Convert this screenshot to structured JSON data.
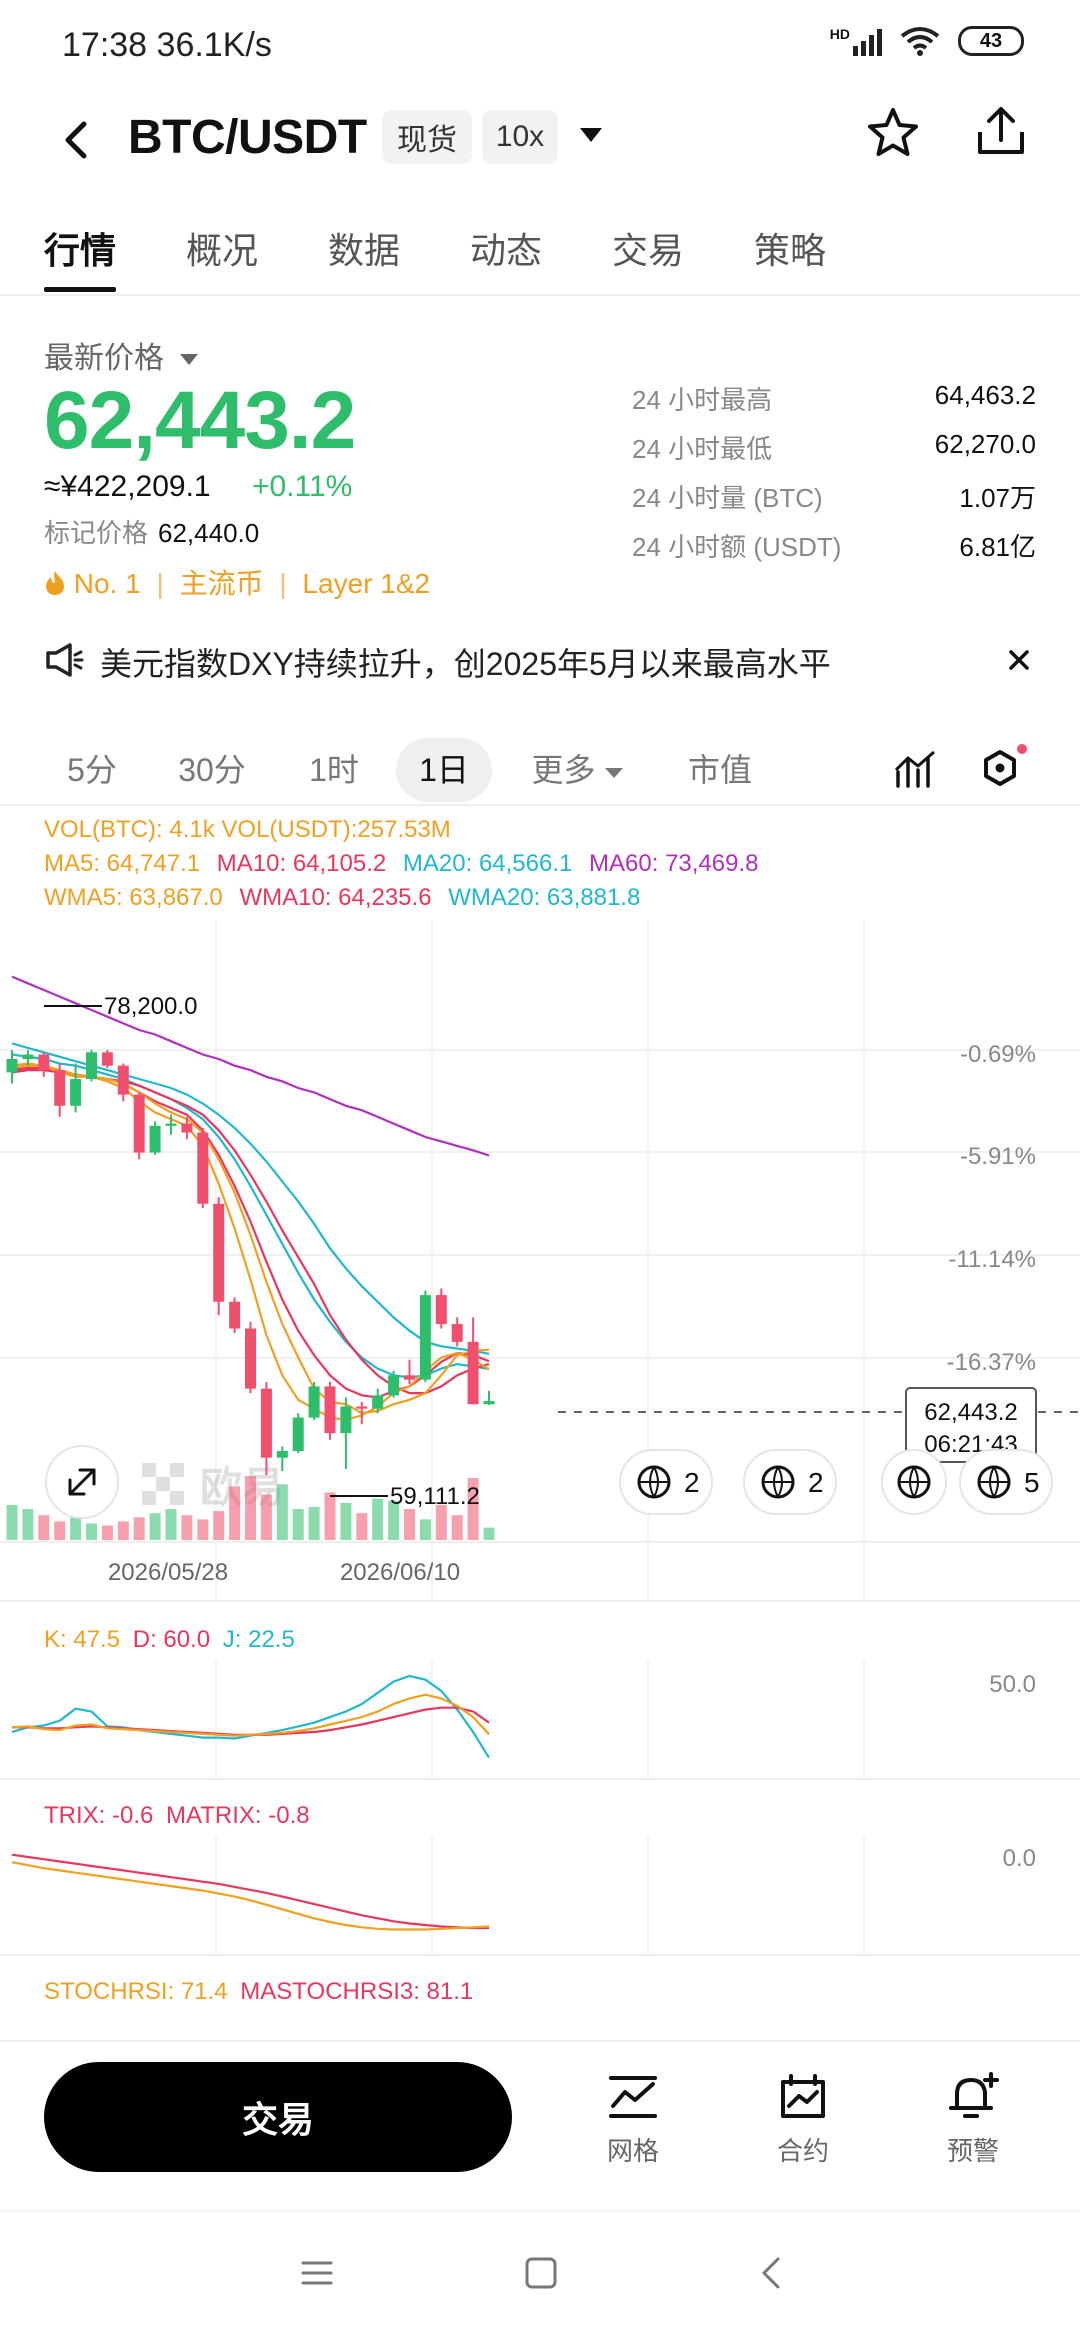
{
  "status_bar": {
    "time": "17:38",
    "speed": "36.1K/s",
    "network": "HD",
    "battery": "43"
  },
  "header": {
    "pair": "BTC/USDT",
    "market_tag": "现货",
    "leverage_tag": "10x"
  },
  "tabs": [
    "行情",
    "概况",
    "数据",
    "动态",
    "交易",
    "策略"
  ],
  "price": {
    "label": "最新价格",
    "last": "62,443.2",
    "cny": "≈¥422,209.1",
    "change": "+0.11%",
    "mark_label": "标记价格",
    "mark_value": "62,440.0",
    "badges": [
      "No. 1",
      "主流币",
      "Layer 1&2"
    ]
  },
  "stats": [
    {
      "label": "24 小时最高",
      "value": "64,463.2"
    },
    {
      "label": "24 小时最低",
      "value": "62,270.0"
    },
    {
      "label": "24 小时量 (BTC)",
      "value": "1.07万"
    },
    {
      "label": "24 小时额 (USDT)",
      "value": "6.81亿"
    }
  ],
  "news": {
    "text": "美元指数DXY持续拉升，创2025年5月以来最高水平"
  },
  "periods": [
    "5分",
    "30分",
    "1时",
    "1日",
    "更多",
    "市值"
  ],
  "active_period": "1日",
  "indicators": {
    "vol_btc": "VOL(BTC): 4.1k",
    "vol_usdt": "VOL(USDT):257.53M",
    "ma5": "MA5: 64,747.1",
    "ma10": "MA10: 64,105.2",
    "ma20": "MA20: 64,566.1",
    "ma60": "MA60: 73,469.8",
    "wma5": "WMA5: 63,867.0",
    "wma10": "WMA10: 64,235.6",
    "wma20": "WMA20: 63,881.8",
    "kdj_k": "K: 47.5",
    "kdj_d": "D: 60.0",
    "kdj_j": "J: 22.5",
    "trix": "TRIX: -0.6",
    "matrix": "MATRIX: -0.8",
    "stochrsi": "STOCHRSI: 71.4",
    "mastochrsi": "MASTOCHRSI3: 81.1"
  },
  "chart": {
    "pct_labels": [
      "-0.69%",
      "-5.91%",
      "-11.14%",
      "-16.37%"
    ],
    "high_label": "78,200.0",
    "low_label": "59,111.2",
    "price_tag": "62,443.2",
    "countdown": "06:21:43",
    "dates": [
      "2026/05/28",
      "2026/06/10"
    ],
    "kdj_axis": "50.0",
    "trix_axis": "0.0",
    "event_badges": [
      "2",
      "2",
      "5"
    ],
    "watermark": "欧易"
  },
  "bottom": {
    "trade": "交易",
    "grid": "网格",
    "contract": "合约",
    "alert": "预警"
  },
  "colors": {
    "up": "#2ebd6b",
    "down": "#f0506e",
    "accent": "#f0a020"
  },
  "chart_data": {
    "type": "candlestick",
    "candles": [
      {
        "o": 77200,
        "h": 78200,
        "l": 76700,
        "c": 77800
      },
      {
        "o": 77800,
        "h": 78200,
        "l": 77500,
        "c": 78000
      },
      {
        "o": 78000,
        "h": 78100,
        "l": 77000,
        "c": 77300
      },
      {
        "o": 77300,
        "h": 77600,
        "l": 75200,
        "c": 75700
      },
      {
        "o": 75700,
        "h": 77600,
        "l": 75400,
        "c": 76900
      },
      {
        "o": 76900,
        "h": 78200,
        "l": 76800,
        "c": 78100
      },
      {
        "o": 78100,
        "h": 78200,
        "l": 77400,
        "c": 77500
      },
      {
        "o": 77500,
        "h": 77600,
        "l": 75900,
        "c": 76200
      },
      {
        "o": 76200,
        "h": 76300,
        "l": 73300,
        "c": 73600
      },
      {
        "o": 73600,
        "h": 75000,
        "l": 73500,
        "c": 74800
      },
      {
        "o": 74800,
        "h": 75300,
        "l": 74400,
        "c": 74900
      },
      {
        "o": 74900,
        "h": 75200,
        "l": 74200,
        "c": 74500
      },
      {
        "o": 74500,
        "h": 74700,
        "l": 71100,
        "c": 71300
      },
      {
        "o": 71300,
        "h": 71600,
        "l": 66300,
        "c": 66900
      },
      {
        "o": 66900,
        "h": 67100,
        "l": 65500,
        "c": 65700
      },
      {
        "o": 65700,
        "h": 66000,
        "l": 62800,
        "c": 63000
      },
      {
        "o": 63000,
        "h": 63300,
        "l": 59111.2,
        "c": 59900
      },
      {
        "o": 59900,
        "h": 60400,
        "l": 59300,
        "c": 60200
      },
      {
        "o": 60200,
        "h": 61900,
        "l": 60100,
        "c": 61700
      },
      {
        "o": 61700,
        "h": 63300,
        "l": 61600,
        "c": 63100
      },
      {
        "o": 63100,
        "h": 63300,
        "l": 60700,
        "c": 61000
      },
      {
        "o": 61000,
        "h": 62600,
        "l": 59400,
        "c": 62200
      },
      {
        "o": 62200,
        "h": 62400,
        "l": 61400,
        "c": 62100
      },
      {
        "o": 62100,
        "h": 63000,
        "l": 61900,
        "c": 62700
      },
      {
        "o": 62700,
        "h": 63800,
        "l": 62600,
        "c": 63600
      },
      {
        "o": 63600,
        "h": 64300,
        "l": 63200,
        "c": 63400
      },
      {
        "o": 63400,
        "h": 67400,
        "l": 63300,
        "c": 67200
      },
      {
        "o": 67200,
        "h": 67500,
        "l": 65700,
        "c": 65900
      },
      {
        "o": 65900,
        "h": 66200,
        "l": 64900,
        "c": 65100
      },
      {
        "o": 65100,
        "h": 66200,
        "l": 62300,
        "c": 62300
      },
      {
        "o": 62300,
        "h": 62900,
        "l": 62270,
        "c": 62443.2
      }
    ],
    "volume": [
      34,
      30,
      24,
      18,
      28,
      16,
      14,
      18,
      22,
      26,
      30,
      24,
      20,
      28,
      52,
      62,
      44,
      54,
      30,
      32,
      46,
      36,
      26,
      40,
      38,
      30,
      20,
      34,
      24,
      60,
      12
    ],
    "ma5": [
      77400,
      77500,
      77500,
      77300,
      77100,
      77000,
      76900,
      76700,
      76300,
      75800,
      75400,
      75100,
      74500,
      73300,
      71800,
      69900,
      67800,
      65900,
      64400,
      63000,
      62400,
      62300,
      61900,
      62000,
      62300,
      62500,
      62800,
      63600,
      64500,
      64700,
      64747.1
    ],
    "ma10": [
      77200,
      77300,
      77300,
      77200,
      77100,
      77000,
      76900,
      76800,
      76600,
      76300,
      76000,
      75700,
      75300,
      74600,
      73700,
      72600,
      71400,
      70100,
      68900,
      67700,
      66300,
      65200,
      64300,
      63600,
      63100,
      62800,
      62800,
      63100,
      63600,
      63900,
      64105.2
    ],
    "ma20": [
      78500,
      78300,
      78100,
      77900,
      77700,
      77500,
      77300,
      77100,
      76900,
      76700,
      76500,
      76200,
      75800,
      75300,
      74700,
      74000,
      73200,
      72300,
      71400,
      70400,
      69300,
      68400,
      67600,
      66900,
      66200,
      65600,
      65100,
      64900,
      64800,
      64700,
      64566.1
    ],
    "ma60": [
      81500,
      81200,
      80900,
      80600,
      80300,
      80000,
      79700,
      79400,
      79100,
      78900,
      78600,
      78300,
      78000,
      77800,
      77500,
      77300,
      77000,
      76800,
      76500,
      76300,
      76000,
      75700,
      75500,
      75200,
      74900,
      74600,
      74300,
      74100,
      73900,
      73700,
      73469.8
    ],
    "wma5": [
      77500,
      77600,
      77500,
      77200,
      77000,
      77000,
      76800,
      76500,
      75900,
      75400,
      75100,
      74800,
      73900,
      72200,
      70200,
      67900,
      65400,
      63600,
      62500,
      62100,
      61700,
      61600,
      61800,
      62200,
      62800,
      63100,
      63800,
      64400,
      64600,
      64300,
      63867
    ],
    "wma10": [
      77300,
      77400,
      77400,
      77200,
      77100,
      77000,
      76900,
      76700,
      76300,
      75900,
      75600,
      75300,
      74600,
      73500,
      72100,
      70500,
      68700,
      67000,
      65600,
      64500,
      63600,
      63000,
      62700,
      62600,
      62900,
      63100,
      63600,
      64200,
      64600,
      64500,
      64235.6
    ],
    "wma20": [
      78000,
      77900,
      77800,
      77600,
      77500,
      77300,
      77100,
      76900,
      76600,
      76300,
      76000,
      75600,
      75100,
      74300,
      73300,
      72100,
      70800,
      69500,
      68200,
      67000,
      66000,
      65100,
      64400,
      63900,
      63600,
      63500,
      63600,
      63900,
      64100,
      64000,
      63881.8
    ],
    "ylim": [
      58000,
      80000
    ],
    "kdj_k": [
      55,
      56,
      53,
      52,
      57,
      58,
      54,
      53,
      52,
      51,
      50,
      49,
      48,
      47,
      46,
      47,
      48,
      49,
      51,
      54,
      58,
      62,
      66,
      72,
      80,
      86,
      90,
      86,
      78,
      66,
      47.5
    ],
    "kdj_d": [
      55,
      55,
      54,
      54,
      55,
      56,
      55,
      54,
      53,
      52,
      51,
      50,
      49,
      48,
      47,
      47,
      47,
      48,
      49,
      50,
      52,
      55,
      58,
      62,
      66,
      70,
      74,
      76,
      76,
      72,
      60.0
    ],
    "kdj_j": [
      50,
      55,
      57,
      62,
      75,
      72,
      56,
      55,
      52,
      50,
      48,
      46,
      44,
      44,
      43,
      46,
      49,
      52,
      56,
      60,
      66,
      72,
      80,
      92,
      104,
      110,
      106,
      94,
      74,
      50,
      22.5
    ],
    "trix": [
      8,
      7.6,
      7.2,
      6.9,
      6.6,
      6.3,
      6.0,
      5.7,
      5.4,
      5.1,
      4.8,
      4.5,
      4.2,
      3.8,
      3.4,
      2.9,
      2.3,
      1.7,
      1.1,
      0.5,
      0,
      -0.4,
      -0.7,
      -0.9,
      -1.0,
      -1.0,
      -1.0,
      -0.9,
      -0.8,
      -0.7,
      -0.6
    ],
    "matrix": [
      9,
      8.7,
      8.4,
      8.1,
      7.8,
      7.5,
      7.2,
      6.9,
      6.6,
      6.3,
      6.0,
      5.7,
      5.4,
      5.1,
      4.7,
      4.3,
      3.9,
      3.4,
      2.9,
      2.4,
      1.9,
      1.4,
      0.9,
      0.5,
      0.1,
      -0.2,
      -0.4,
      -0.6,
      -0.7,
      -0.8,
      -0.8
    ]
  }
}
